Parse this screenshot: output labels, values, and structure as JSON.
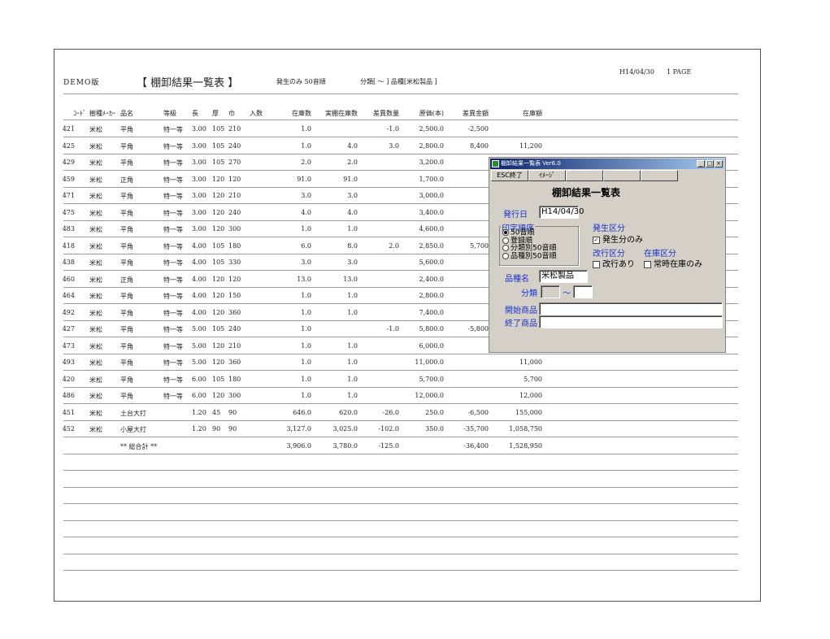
{
  "report": {
    "brand": "DEMO版",
    "title": "【 棚卸結果一覧表 】",
    "options": "発生のみ  50音順",
    "range": "分類[    ～    ] 品種[米松製品    ]",
    "date": "H14/04/30",
    "page": "1 PAGE",
    "columns": [
      "ｺｰﾄﾞ",
      "樹種ﾒｰｶｰ",
      "品名",
      "等級",
      "長",
      "厚",
      "巾",
      "入数",
      "在庫数",
      "実棚在庫数",
      "差異数量",
      "原価(本)",
      "差異金額",
      "在庫額"
    ],
    "rows": [
      [
        "421",
        "米松",
        "平角",
        "特一等",
        "3.00",
        "105",
        "210",
        "",
        "1.0",
        "",
        "-1.0",
        "2,500.0",
        "-2,500",
        ""
      ],
      [
        "425",
        "米松",
        "平角",
        "特一等",
        "3.00",
        "105",
        "240",
        "",
        "1.0",
        "4.0",
        "3.0",
        "2,800.0",
        "8,400",
        "11,200"
      ],
      [
        "429",
        "米松",
        "平角",
        "特一等",
        "3.00",
        "105",
        "270",
        "",
        "2.0",
        "2.0",
        "",
        "3,200.0",
        "",
        ""
      ],
      [
        "459",
        "米松",
        "正角",
        "特一等",
        "3.00",
        "120",
        "120",
        "",
        "91.0",
        "91.0",
        "",
        "1,700.0",
        "",
        ""
      ],
      [
        "471",
        "米松",
        "平角",
        "特一等",
        "3.00",
        "120",
        "210",
        "",
        "3.0",
        "3.0",
        "",
        "3,000.0",
        "",
        ""
      ],
      [
        "475",
        "米松",
        "平角",
        "特一等",
        "3.00",
        "120",
        "240",
        "",
        "4.0",
        "4.0",
        "",
        "3,400.0",
        "",
        ""
      ],
      [
        "483",
        "米松",
        "平角",
        "特一等",
        "3.00",
        "120",
        "300",
        "",
        "1.0",
        "1.0",
        "",
        "4,600.0",
        "",
        ""
      ],
      [
        "418",
        "米松",
        "平角",
        "特一等",
        "4.00",
        "105",
        "180",
        "",
        "6.0",
        "8.0",
        "2.0",
        "2,850.0",
        "5,700",
        ""
      ],
      [
        "438",
        "米松",
        "平角",
        "特一等",
        "4.00",
        "105",
        "330",
        "",
        "3.0",
        "3.0",
        "",
        "5,600.0",
        "",
        ""
      ],
      [
        "460",
        "米松",
        "正角",
        "特一等",
        "4.00",
        "120",
        "120",
        "",
        "13.0",
        "13.0",
        "",
        "2,400.0",
        "",
        ""
      ],
      [
        "464",
        "米松",
        "平角",
        "特一等",
        "4.00",
        "120",
        "150",
        "",
        "1.0",
        "1.0",
        "",
        "2,800.0",
        "",
        ""
      ],
      [
        "492",
        "米松",
        "平角",
        "特一等",
        "4.00",
        "120",
        "360",
        "",
        "1.0",
        "1.0",
        "",
        "7,400.0",
        "",
        ""
      ],
      [
        "427",
        "米松",
        "平角",
        "特一等",
        "5.00",
        "105",
        "240",
        "",
        "1.0",
        "",
        "-1.0",
        "5,800.0",
        "-5,800",
        ""
      ],
      [
        "473",
        "米松",
        "平角",
        "特一等",
        "5.00",
        "120",
        "210",
        "",
        "1.0",
        "1.0",
        "",
        "6,000.0",
        "",
        ""
      ],
      [
        "493",
        "米松",
        "平角",
        "特一等",
        "5.00",
        "120",
        "360",
        "",
        "1.0",
        "1.0",
        "",
        "11,000.0",
        "",
        "11,000"
      ],
      [
        "420",
        "米松",
        "平角",
        "特一等",
        "6.00",
        "105",
        "180",
        "",
        "1.0",
        "1.0",
        "",
        "5,700.0",
        "",
        "5,700"
      ],
      [
        "486",
        "米松",
        "平角",
        "特一等",
        "6.00",
        "120",
        "300",
        "",
        "1.0",
        "1.0",
        "",
        "12,000.0",
        "",
        "12,000"
      ],
      [
        "451",
        "米松",
        "土台大打",
        "",
        "1.20",
        "45",
        "90",
        "",
        "646.0",
        "620.0",
        "-26.0",
        "250.0",
        "-6,500",
        "155,000"
      ],
      [
        "452",
        "米松",
        "小屋大打",
        "",
        "1.20",
        "90",
        "90",
        "",
        "3,127.0",
        "3,025.0",
        "-102.0",
        "350.0",
        "-35,700",
        "1,058,750"
      ]
    ],
    "total": {
      "label": "** 総合計 **",
      "stock": "3,906.0",
      "actual": "3,780.0",
      "diff_qty": "-125.0",
      "diff_amt": "-36,400",
      "stock_amt": "1,528,950"
    }
  },
  "dialog": {
    "title": "棚卸結果一覧表 Ver6.0",
    "esc_button": "ESC終了",
    "image_button": "ｲﾒｰｼﾞ",
    "heading": "棚卸結果一覧表",
    "issue_date_label": "発行日",
    "issue_date_value": "H14/04/30",
    "print_order_label": "印字順序",
    "print_order_options": [
      "50音順",
      "登録順",
      "分類別50音順",
      "品種別50音順"
    ],
    "occurrence_label": "発生区分",
    "occurrence_check": "発生分のみ",
    "page_break_label": "改行区分",
    "page_break_check": "改行あり",
    "stock_label": "在庫区分",
    "stock_check": "常時在庫のみ",
    "product_type_label": "品種名",
    "product_type_value": "米松製品",
    "category_label": "分類",
    "category_tilde": "～",
    "start_item_label": "開始商品",
    "end_item_label": "終了商品"
  }
}
